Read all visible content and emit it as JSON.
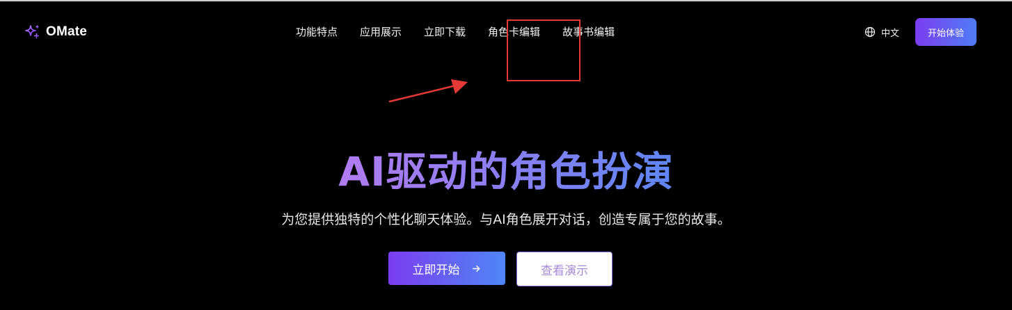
{
  "header": {
    "brand": {
      "name": "OMate",
      "icon": "sparkle-icon"
    },
    "nav": [
      {
        "label": "功能特点"
      },
      {
        "label": "应用展示"
      },
      {
        "label": "立即下载"
      },
      {
        "label": "角色卡编辑"
      },
      {
        "label": "故事书编辑"
      }
    ],
    "language": {
      "icon": "globe-icon",
      "label": "中文"
    },
    "cta_label": "开始体验"
  },
  "hero": {
    "title": "AI驱动的角色扮演",
    "subtitle": "为您提供独特的个性化聊天体验。与AI角色展开对话，创造专属于您的故事。",
    "primary_button": {
      "label": "立即开始",
      "icon": "arrow-right-icon"
    },
    "secondary_button": {
      "label": "查看演示"
    }
  },
  "annotation": {
    "color": "#e53935",
    "highlighted_item": "角色卡编辑"
  },
  "theme": {
    "background": "#000000",
    "accent_start": "#7b3df0",
    "accent_end": "#4f86f7"
  }
}
